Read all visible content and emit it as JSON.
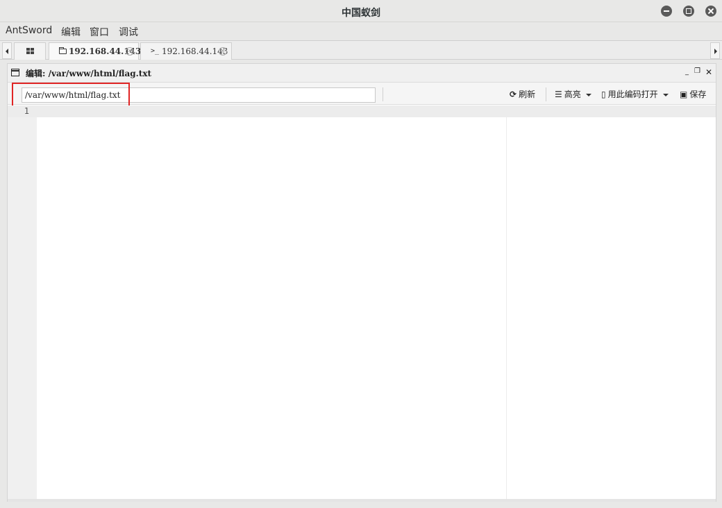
{
  "window": {
    "title": "中国蚁剑"
  },
  "menubar": {
    "items": [
      "AntSword",
      "编辑",
      "窗口",
      "调试"
    ]
  },
  "tabs": [
    {
      "label": "192.168.44.143",
      "icon": "folder-icon",
      "active": true
    },
    {
      "label": "192.168.44.143",
      "icon": "terminal-icon",
      "active": false
    }
  ],
  "panel": {
    "title": "编辑: /var/www/html/flag.txt"
  },
  "toolbar": {
    "path_value": "/var/www/html/flag.txt",
    "refresh_label": "刷新",
    "highlight_label": "高亮",
    "open_encoding_label": "用此编码打开",
    "save_label": "保存"
  },
  "editor": {
    "line_numbers": [
      "1"
    ],
    "content": ""
  },
  "colors": {
    "highlight_box": "#e02424",
    "titlebar_bg": "#e8e8e7"
  }
}
